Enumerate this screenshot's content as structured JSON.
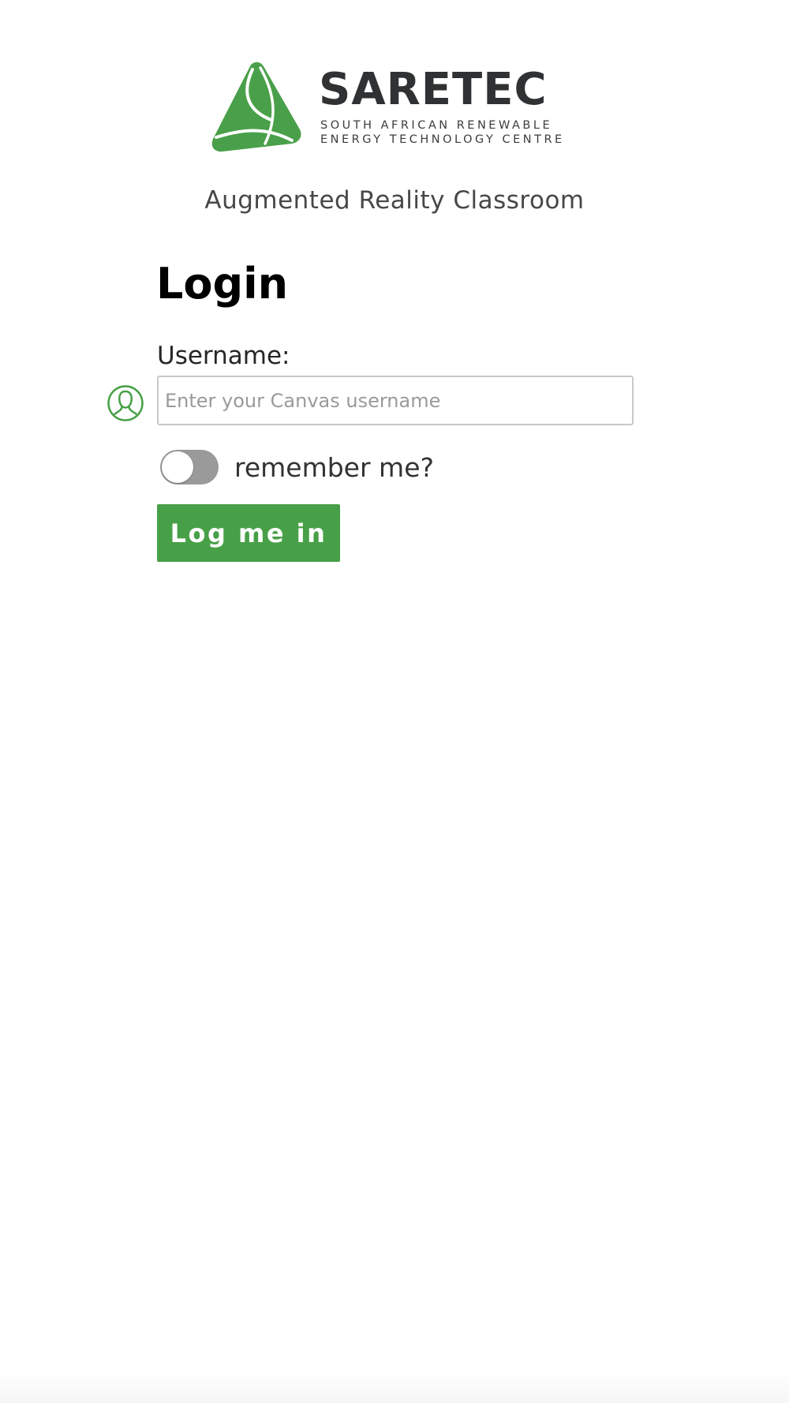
{
  "brand": {
    "name": "SARETEC",
    "tagline_line1": "SOUTH AFRICAN RENEWABLE",
    "tagline_line2": "ENERGY TECHNOLOGY CENTRE",
    "accent_color": "#47a047",
    "logo_icon": "saretec-triangle-logo"
  },
  "subtitle": "Augmented Reality Classroom",
  "login": {
    "title": "Login",
    "username_label": "Username:",
    "username_value": "",
    "username_placeholder": "Enter your Canvas username",
    "username_icon": "user-icon",
    "remember_label": "remember me?",
    "remember_checked": false,
    "submit_label": "Log me in"
  }
}
